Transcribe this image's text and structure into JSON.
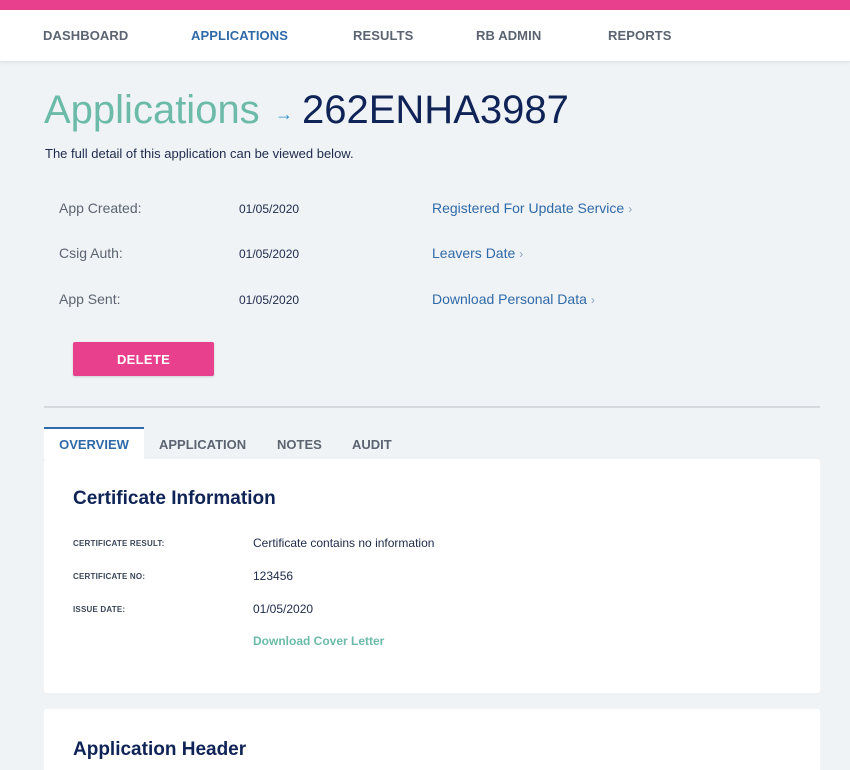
{
  "nav": {
    "items": [
      {
        "label": "DASHBOARD",
        "active": false
      },
      {
        "label": "APPLICATIONS",
        "active": true
      },
      {
        "label": "RESULTS",
        "active": false
      },
      {
        "label": "RB ADMIN",
        "active": false
      },
      {
        "label": "REPORTS",
        "active": false
      }
    ]
  },
  "header": {
    "title": "Applications",
    "arrow_glyph": "→",
    "application_id": "262ENHA3987",
    "intro": "The full detail of this application can be viewed below."
  },
  "meta": {
    "rows": [
      {
        "label": "App Created:",
        "value": "01/05/2020",
        "link": "Registered For Update Service"
      },
      {
        "label": "Csig Auth:",
        "value": "01/05/2020",
        "link": "Leavers Date"
      },
      {
        "label": "App Sent:",
        "value": "01/05/2020",
        "link": "Download Personal Data"
      }
    ],
    "chevron": "›"
  },
  "actions": {
    "delete_label": "DELETE"
  },
  "tabs": [
    {
      "label": "OVERVIEW",
      "active": true
    },
    {
      "label": "APPLICATION",
      "active": false
    },
    {
      "label": "NOTES",
      "active": false
    },
    {
      "label": "AUDIT",
      "active": false
    }
  ],
  "certificate": {
    "title": "Certificate Information",
    "fields": [
      {
        "label": "CERTIFICATE RESULT:",
        "value": "Certificate contains no information"
      },
      {
        "label": "CERTIFICATE NO:",
        "value": "123456"
      },
      {
        "label": "ISSUE DATE:",
        "value": "01/05/2020"
      }
    ],
    "cover_letter_link": "Download Cover Letter"
  },
  "application_header": {
    "title": "Application Header"
  },
  "colors": {
    "brand_pink": "#e8408d",
    "accent_teal": "#6bbba8",
    "link_blue": "#2f6aa8",
    "navy": "#0f2357"
  }
}
